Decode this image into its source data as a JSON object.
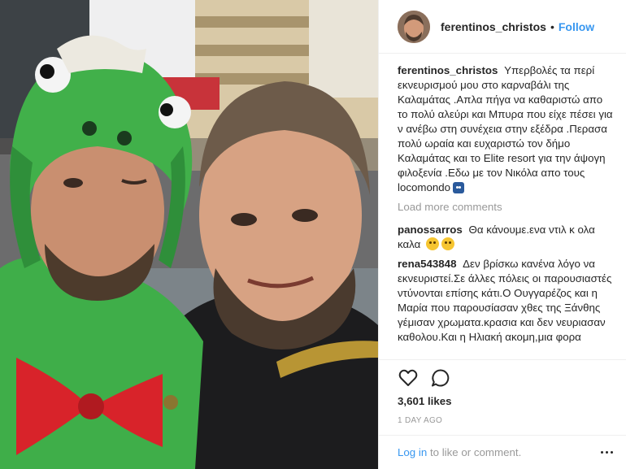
{
  "post": {
    "username": "ferentinos_christos",
    "separator": "•",
    "follow_label": "Follow"
  },
  "caption": {
    "username": "ferentinos_christos",
    "text": "Υπερβολές τα περί εκνευρισμού μου στο καρναβάλι της Καλαμάτας .Απλα πήγα να καθαριστώ απο το πολύ αλεύρι και Μπυρα που είχε πέσει για ν ανέβω στη συνέχεια στην εξέδρα .Περασα πολύ ωραία και ευχαριστώ τον δήμο Καλαμάτας και το Elite resort για την άψογη φιλοξενία .Εδω με τον Νικόλα απο τους locomondo"
  },
  "load_more_label": "Load more comments",
  "comments": [
    {
      "username": "panossarros",
      "text": "Θα κάνουμε.ενα ντιλ κ ολα καλα"
    },
    {
      "username": "rena543848",
      "text": "Δεν βρίσκω κανένα λόγο να εκνευριστεί.Σε άλλες πόλεις οι παρουσιαστές ντύνονται επίσης κάτι.Ο Ουγγαρέζος και η Μαρία που παρουσίασαν χθες της Ξάνθης γέμισαν χρωματα.κρασια και δεν νευριασαν καθολου.Και η Ηλιακή ακομη,μια φορα"
    }
  ],
  "likes": {
    "count": "3,601",
    "suffix": "likes"
  },
  "timestamp": "1 day ago",
  "login": {
    "link_label": "Log in",
    "rest_text": "to like or comment."
  },
  "icons": {
    "like": "heart-outline-icon",
    "comment": "speech-bubble-icon",
    "more": "more-options-icon"
  },
  "colors": {
    "link_blue": "#3897f0",
    "muted_gray": "#999999",
    "text_dark": "#262626",
    "costume_green": "#3fae49",
    "bow_red": "#d8232a"
  }
}
